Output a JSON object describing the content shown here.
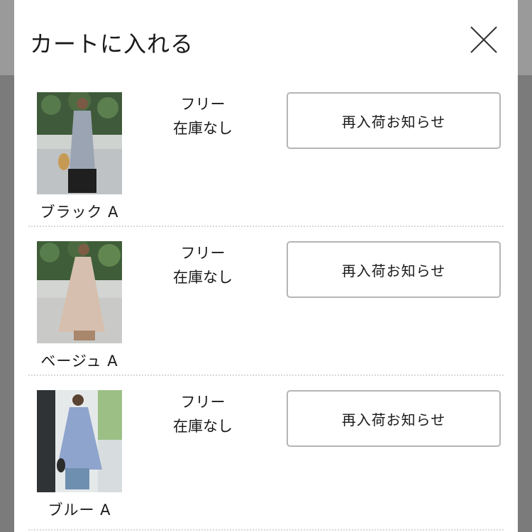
{
  "modal": {
    "title": "カートに入れる",
    "close_icon": "close-icon"
  },
  "items": [
    {
      "color": "ブラック A",
      "size": "フリー",
      "stock": "在庫なし",
      "button_label": "再入荷お知らせ"
    },
    {
      "color": "ベージュ A",
      "size": "フリー",
      "stock": "在庫なし",
      "button_label": "再入荷お知らせ"
    },
    {
      "color": "ブルー A",
      "size": "フリー",
      "stock": "在庫なし",
      "button_label": "再入荷お知らせ"
    }
  ],
  "colors": {
    "overlay": "#7b7b7b",
    "text": "#1a1a1a",
    "button_border": "#b5b5b5",
    "divider": "#d8d8d8"
  }
}
